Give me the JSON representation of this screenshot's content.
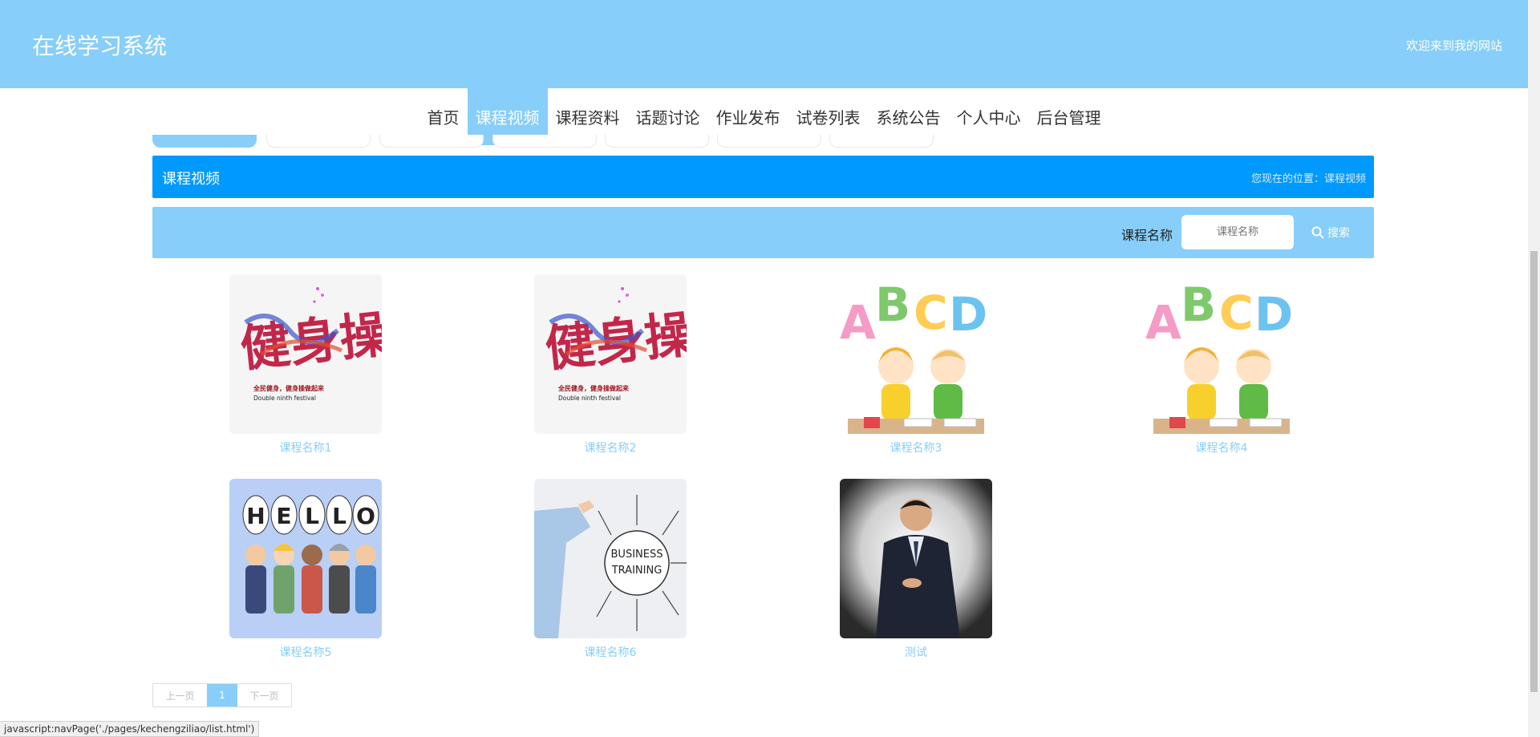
{
  "header": {
    "site_title": "在线学习系统",
    "welcome": "欢迎来到我的网站"
  },
  "nav": {
    "items": [
      {
        "label": "首页",
        "active": false
      },
      {
        "label": "课程视频",
        "active": true
      },
      {
        "label": "课程资料",
        "active": false
      },
      {
        "label": "话题讨论",
        "active": false
      },
      {
        "label": "作业发布",
        "active": false
      },
      {
        "label": "试卷列表",
        "active": false
      },
      {
        "label": "系统公告",
        "active": false
      },
      {
        "label": "个人中心",
        "active": false
      },
      {
        "label": "后台管理",
        "active": false
      }
    ]
  },
  "breadcrumb": {
    "title": "课程视频",
    "location": "您现在的位置：课程视频"
  },
  "search": {
    "label": "课程名称",
    "placeholder": "课程名称",
    "button": "搜索"
  },
  "courses": [
    {
      "name": "课程名称1",
      "image": "fitness-poster"
    },
    {
      "name": "课程名称2",
      "image": "fitness-poster"
    },
    {
      "name": "课程名称3",
      "image": "abcd-kids"
    },
    {
      "name": "课程名称4",
      "image": "abcd-kids"
    },
    {
      "name": "课程名称5",
      "image": "hello-people"
    },
    {
      "name": "课程名称6",
      "image": "business-training"
    },
    {
      "name": "测试",
      "image": "man-in-suit"
    }
  ],
  "fitness_poster": {
    "title": "健身操",
    "line1": "全民健身，健身操做起来",
    "line2": "Double ninth festival"
  },
  "abcd_letters": [
    "A",
    "B",
    "C",
    "D"
  ],
  "hello_letters": [
    "H",
    "E",
    "L",
    "L",
    "O"
  ],
  "business_text": [
    "BUSINESS",
    "TRAINING"
  ],
  "pagination": {
    "prev": "上一页",
    "current": "1",
    "next": "下一页"
  },
  "status_bar": "javascript:navPage('./pages/kechengziliao/list.html')",
  "colors": {
    "header_bg": "#87CEFA",
    "crumb_bg": "#0099ff",
    "caption": "#87CEFA"
  }
}
